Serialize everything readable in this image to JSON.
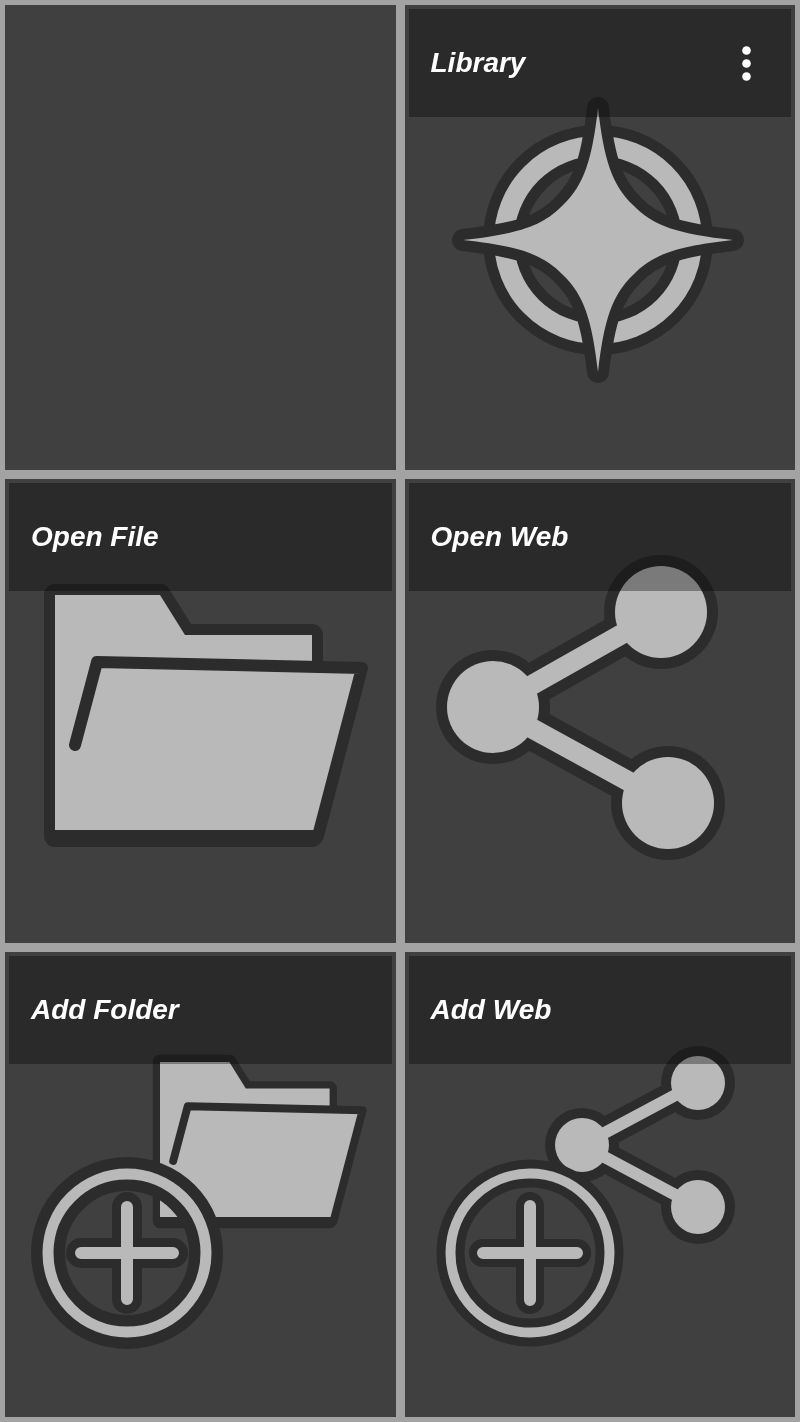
{
  "tiles": [
    {
      "kind": "empty"
    },
    {
      "kind": "action",
      "title": "Library",
      "menu": true
    },
    {
      "kind": "action",
      "title": "Open File",
      "menu": false
    },
    {
      "kind": "action",
      "title": "Open Web",
      "menu": false
    },
    {
      "kind": "action",
      "title": "Add Folder",
      "menu": false
    },
    {
      "kind": "action",
      "title": "Add Web",
      "menu": false
    }
  ]
}
